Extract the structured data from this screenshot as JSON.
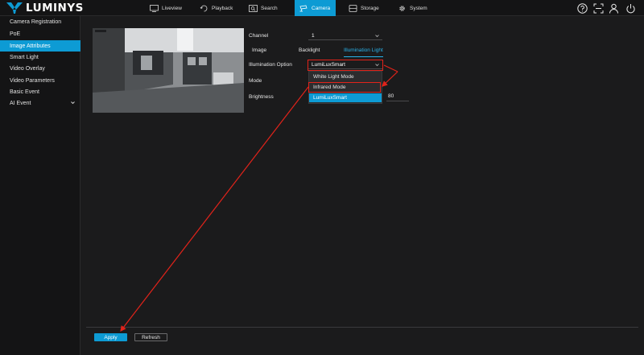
{
  "brand": {
    "name": "LUMINYS"
  },
  "nav": [
    {
      "label": "Liveview",
      "icon": "monitor-icon"
    },
    {
      "label": "Playback",
      "icon": "playback-icon"
    },
    {
      "label": "Search",
      "icon": "search-icon"
    },
    {
      "label": "Camera",
      "icon": "camera-icon",
      "active": true
    },
    {
      "label": "Storage",
      "icon": "storage-icon"
    },
    {
      "label": "System",
      "icon": "gear-icon"
    }
  ],
  "top_icons": [
    "help-icon",
    "scan-icon",
    "user-icon",
    "power-icon"
  ],
  "sidebar": {
    "items": [
      {
        "label": "Camera Registration"
      },
      {
        "label": "PoE"
      },
      {
        "label": "Image Attributes",
        "active": true
      },
      {
        "label": "Smart Light"
      },
      {
        "label": "Video Overlay"
      },
      {
        "label": "Video Parameters"
      },
      {
        "label": "Basic Event"
      },
      {
        "label": "AI Event",
        "expandable": true
      }
    ]
  },
  "preview": {
    "timestamp": ""
  },
  "settings": {
    "channel_label": "Channel",
    "channel_value": "1",
    "tabs": [
      "Image",
      "Backlight",
      "Illumination Light"
    ],
    "active_tab": "Illumination Light",
    "illumination_option_label": "Illumination Option",
    "illumination_option_value": "LumiLuxSmart",
    "mode_label": "Mode",
    "brightness_label": "Brightness",
    "brightness_value": "80",
    "dropdown_options": [
      "White Light Mode",
      "Infrared Mode",
      "LumiLuxSmart"
    ],
    "dropdown_selected": "LumiLuxSmart"
  },
  "footer": {
    "apply_label": "Apply",
    "refresh_label": "Refresh"
  },
  "colors": {
    "accent": "#0d9bd4",
    "annotation": "#e2231a",
    "background": "#1b1b1c"
  }
}
